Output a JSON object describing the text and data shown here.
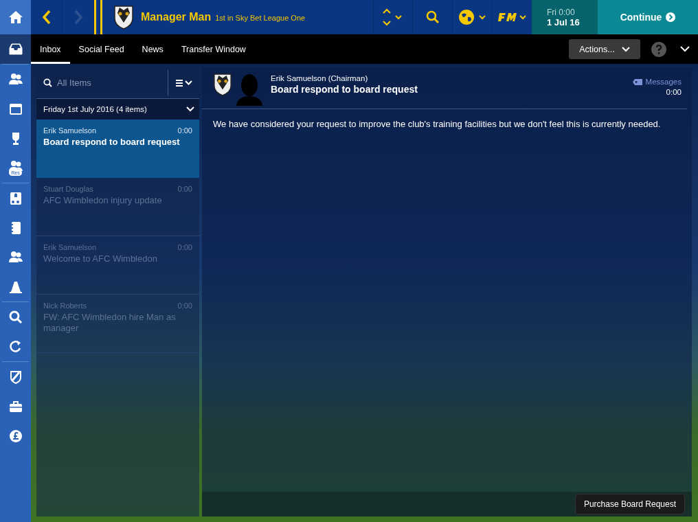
{
  "header": {
    "manager": "Manager Man",
    "position": "1st in Sky Bet League One",
    "date_day": "Fri 0:00",
    "date": "1 Jul 16",
    "continue": "Continue"
  },
  "sidebar": {
    "items": [
      {
        "kind": "inbox",
        "selected": true
      },
      {
        "kind": "squad",
        "selected": false
      },
      {
        "kind": "calendar",
        "selected": false
      },
      {
        "kind": "trophy",
        "selected": false
      },
      {
        "kind": "reserves",
        "selected": false,
        "badge": "Res"
      },
      {
        "kind": "tactics",
        "selected": false
      },
      {
        "kind": "notebook",
        "selected": false
      },
      {
        "kind": "staff",
        "selected": false
      },
      {
        "kind": "cone",
        "selected": false
      },
      {
        "kind": "search",
        "selected": false
      },
      {
        "kind": "refresh",
        "selected": false
      },
      {
        "kind": "shield",
        "selected": false
      },
      {
        "kind": "briefcase",
        "selected": false
      },
      {
        "kind": "pound",
        "selected": false
      }
    ]
  },
  "tabs": [
    {
      "label": "Inbox",
      "selected": true
    },
    {
      "label": "Social Feed",
      "selected": false
    },
    {
      "label": "News",
      "selected": false
    },
    {
      "label": "Transfer Window",
      "selected": false
    }
  ],
  "actions": "Actions...",
  "inbox": {
    "search": {
      "placeholder": "All Items"
    },
    "group": "Friday 1st July 2016 (4 items)",
    "messages": [
      {
        "sender": "Erik Samuelson",
        "time": "0:00",
        "subject": "Board respond to board request",
        "selected": true,
        "read": false
      },
      {
        "sender": "Stuart Douglas",
        "time": "0:00",
        "subject": "AFC Wimbledon injury update",
        "selected": false,
        "read": true
      },
      {
        "sender": "Erik Samuelson",
        "time": "0:00",
        "subject": "Welcome to AFC Wimbledon",
        "selected": false,
        "read": true
      },
      {
        "sender": "Nick Roberts",
        "time": "0:00",
        "subject": "FW: AFC Wimbledon hire Man as manager",
        "selected": false,
        "read": true
      }
    ]
  },
  "message": {
    "sender": "Erik Samuelson  (Chairman)",
    "subject": "Board respond to board request",
    "category": "Messages",
    "time": "0:00",
    "body": "We have considered your request to improve the club's training facilities but we don't feel this is currently needed.",
    "action": "Purchase Board Request"
  }
}
